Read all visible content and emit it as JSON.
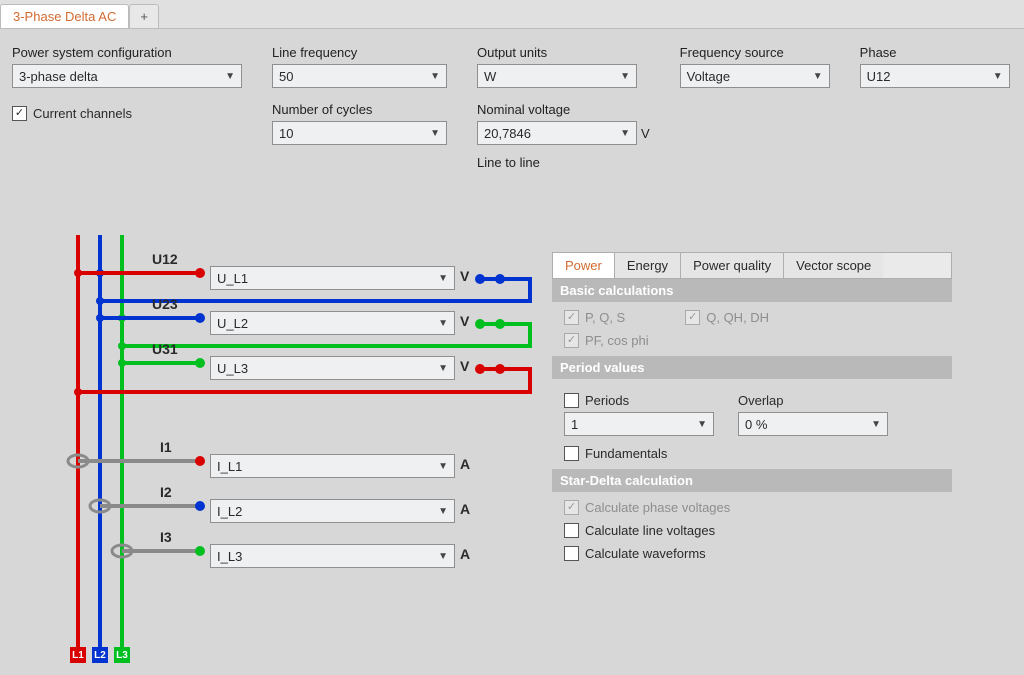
{
  "tabs": {
    "active": "3-Phase Delta AC",
    "plus": "+"
  },
  "labels": {
    "power_config": "Power system configuration",
    "line_freq": "Line frequency",
    "output_units": "Output units",
    "freq_source": "Frequency source",
    "phase": "Phase",
    "num_cycles": "Number of cycles",
    "nominal_voltage": "Nominal voltage",
    "line_to_line": "Line to line",
    "current_channels": "Current channels"
  },
  "values": {
    "power_config": "3-phase delta",
    "line_freq": "50",
    "output_units": "W",
    "freq_source": "Voltage",
    "phase": "U12",
    "num_cycles": "10",
    "nominal_voltage": "20,7846",
    "nominal_voltage_unit": "V"
  },
  "diagram": {
    "u_labels": [
      "U12",
      "U23",
      "U31"
    ],
    "i_labels": [
      "I1",
      "I2",
      "I3"
    ],
    "u_values": [
      "U_L1",
      "U_L2",
      "U_L3"
    ],
    "i_values": [
      "I_L1",
      "I_L2",
      "I_L3"
    ],
    "u_unit": "V",
    "i_unit": "A",
    "bus_labels": [
      "L1",
      "L2",
      "L3"
    ]
  },
  "right": {
    "tabs": [
      "Power",
      "Energy",
      "Power quality",
      "Vector scope"
    ],
    "sections": {
      "basic": "Basic calculations",
      "period": "Period values",
      "stardelta": "Star-Delta calculation"
    },
    "basic": {
      "pqs": "P, Q, S",
      "qqh": "Q, QH, DH",
      "pf": "PF, cos phi"
    },
    "period": {
      "periods": "Periods",
      "overlap": "Overlap",
      "periods_val": "1",
      "overlap_val": "0 %",
      "fundamentals": "Fundamentals"
    },
    "stardelta": {
      "phase": "Calculate phase voltages",
      "line": "Calculate line voltages",
      "wave": "Calculate waveforms"
    }
  }
}
